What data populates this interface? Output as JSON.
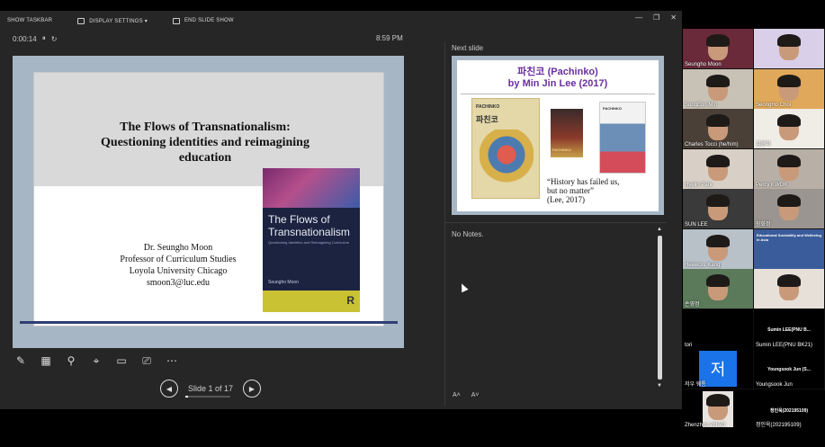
{
  "toolbar": {
    "show_taskbar": "SHOW TASKBAR",
    "display_settings": "DISPLAY SETTINGS ▾",
    "end_slide_show": "END SLIDE SHOW"
  },
  "window_controls": {
    "minimize": "—",
    "restore": "❐",
    "close": "✕"
  },
  "timer": {
    "elapsed": "0:00:14",
    "pause": "⏸",
    "reset": "↻"
  },
  "clock": "8:59 PM",
  "current_slide": {
    "title_line1": "The Flows of Transnationalism:",
    "title_line2": "Questioning identities and reimagining",
    "title_line3": "education",
    "author_name": "Dr. Seungho Moon",
    "author_title": "Professor of Curriculum Studies",
    "author_affiliation": "Loyola University Chicago",
    "author_email": "smoon3@luc.edu",
    "book_title": "The Flows of Transnationalism",
    "book_subtitle": "Questioning Identities and Reimagining Curriculum",
    "book_author": "Seungho Moon",
    "book_publisher_logo": "R"
  },
  "slide_nav": {
    "prev": "◀",
    "next": "▶",
    "counter": "Slide 1 of 17",
    "progress": 0.06
  },
  "next_slide": {
    "label": "Next slide",
    "title_line1": "파친코 (Pachinko)",
    "title_line2": "by Min Jin Lee (2017)",
    "cover1_title": "PACHINKO",
    "cover1_korean": "파친코",
    "cover2_label": "PACHINKO",
    "cover3_label": "PACHINKO",
    "quote_line1": "“History has failed us,",
    "quote_line2": "but no matter”",
    "quote_line3": "(Lee, 2017)"
  },
  "notes": {
    "text": "No Notes."
  },
  "font_buttons": {
    "increase": "A˄",
    "decrease": "A˅"
  },
  "tools": [
    "✎",
    "▦",
    "⚲",
    "⌖",
    "▭",
    "⎚",
    "⋯"
  ],
  "participants": [
    {
      "name": "Seungho Moon",
      "bg": "#6a2a3a"
    },
    {
      "name": "",
      "bg": "#d9cfe8"
    },
    {
      "name": "SungEun Min",
      "bg": "#c8c2b6"
    },
    {
      "name": "SeongHo Choi",
      "bg": "#e0a85a"
    },
    {
      "name": "Charles Tocci (he/him)",
      "bg": "#4a4038"
    },
    {
      "name": "김현미",
      "bg": "#f0ece6"
    },
    {
      "name": "Hyelin Park",
      "bg": "#d8d0c6"
    },
    {
      "name": "Percy KWOK",
      "bg": "#b8b0a6"
    },
    {
      "name": "SUN LEE",
      "bg": "#3a3a3a"
    },
    {
      "name": "장화정",
      "bg": "#9a9590"
    },
    {
      "name": "Heewon. Kang",
      "bg": "#b8c0c8"
    },
    {
      "name": "",
      "bg": "#3b5c9a"
    },
    {
      "name": "손영정",
      "bg": "#5a7a5a"
    },
    {
      "name": "",
      "bg": "#e6e0d8"
    },
    {
      "name": "tori",
      "bg": "#000000"
    },
    {
      "name": "Sumin LEE(PNU BK21)",
      "bg": "#000000"
    },
    {
      "name": "저우 웨통",
      "bg": "#000000"
    },
    {
      "name": "Youngsook Jun",
      "bg": "#000000"
    },
    {
      "name": "Zhenzhou ZHAO",
      "bg": "#000000"
    },
    {
      "name": "정인욱(202195109)",
      "bg": "#000000"
    }
  ],
  "labels": {
    "sumin_top": "Sumin LEE(PNU B...",
    "youngsook_top": "Youngsook Jun (S...",
    "jungin_top": "정인욱(202195109)",
    "jeo_glyph": "저",
    "webinar_text": "Educational Sociability and Wellbeing in Asia"
  }
}
